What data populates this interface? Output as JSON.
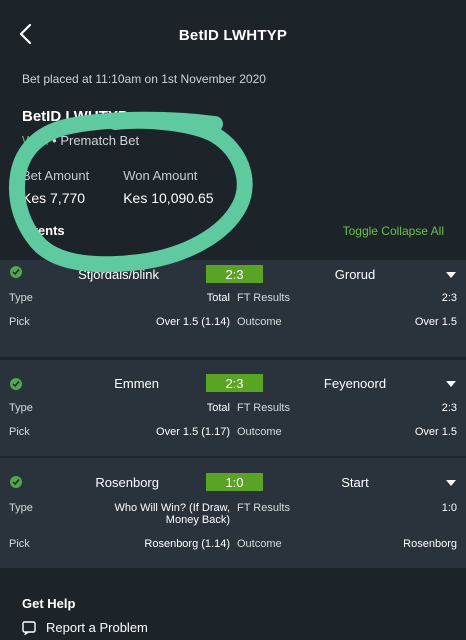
{
  "header": {
    "title": "BetID LWHTYP"
  },
  "bet_placed": "Bet placed at 11:10am on 1st November 2020",
  "bet": {
    "id_label": "BetID LWHTYP",
    "status": "Won",
    "separator": "•",
    "type": "Prematch Bet"
  },
  "amounts": {
    "bet_label": "Bet Amount",
    "bet_value": "Kes 7,770",
    "won_label": "Won Amount",
    "won_value": "Kes 10,090.65"
  },
  "events_header": {
    "label": "Events",
    "toggle": "Toggle Collapse All"
  },
  "events": [
    {
      "home": "Stjordals/blink",
      "score": "2:3",
      "away": "Grorud",
      "type_label": "Type",
      "type_value": "Total",
      "ft_label": "FT Results",
      "ft_value": "2:3",
      "pick_label": "Pick",
      "pick_value": "Over 1.5 (1.14)",
      "outcome_label": "Outcome",
      "outcome_value": "Over 1.5"
    },
    {
      "home": "Emmen",
      "score": "2:3",
      "away": "Feyenoord",
      "type_label": "Type",
      "type_value": "Total",
      "ft_label": "FT Results",
      "ft_value": "2:3",
      "pick_label": "Pick",
      "pick_value": "Over 1.5 (1.17)",
      "outcome_label": "Outcome",
      "outcome_value": "Over 1.5"
    },
    {
      "home": "Rosenborg",
      "score": "1:0",
      "away": "Start",
      "type_label": "Type",
      "type_value_line1": "Who Will Win? (If Draw,",
      "type_value_line2": "Money Back)",
      "ft_label": "FT Results",
      "ft_value": "1:0",
      "pick_label": "Pick",
      "pick_value": "Rosenborg (1.14)",
      "outcome_label": "Outcome",
      "outcome_value": "Rosenborg"
    }
  ],
  "help": {
    "title": "Get Help",
    "report": "Report a Problem"
  },
  "colors": {
    "background": "#1c2329",
    "card": "#2a333b",
    "accent_green": "#5aa324",
    "toggle_green": "#6cc04a",
    "scribble": "#5fcaa0"
  },
  "icons": [
    "back-chevron-icon",
    "check-circle-icon",
    "caret-down-icon",
    "report-icon"
  ]
}
